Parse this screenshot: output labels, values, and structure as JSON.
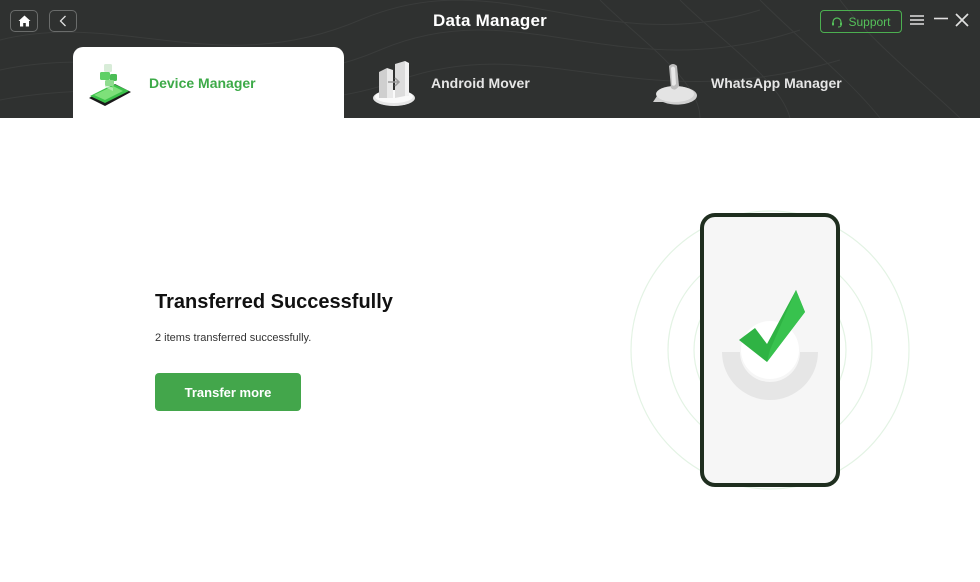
{
  "window": {
    "title": "Data Manager",
    "support_label": "Support",
    "controls": {
      "home": "home-icon",
      "back": "chevron-left-icon",
      "menu": "hamburger-menu-icon",
      "minimize": "minimize-icon",
      "close": "close-icon"
    }
  },
  "tabs": [
    {
      "label": "Device Manager",
      "icon": "device-manager-icon",
      "active": true
    },
    {
      "label": "Android Mover",
      "icon": "android-mover-icon",
      "active": false
    },
    {
      "label": "WhatsApp Manager",
      "icon": "whatsapp-manager-icon",
      "active": false
    }
  ],
  "result": {
    "title": "Transferred Successfully",
    "message": "2 items transferred successfully.",
    "button_label": "Transfer more",
    "status_icon": "success-checkmark-icon"
  },
  "colors": {
    "accent": "#43a64b",
    "header_bg": "#2f3130",
    "check_green": "#2fb344"
  }
}
